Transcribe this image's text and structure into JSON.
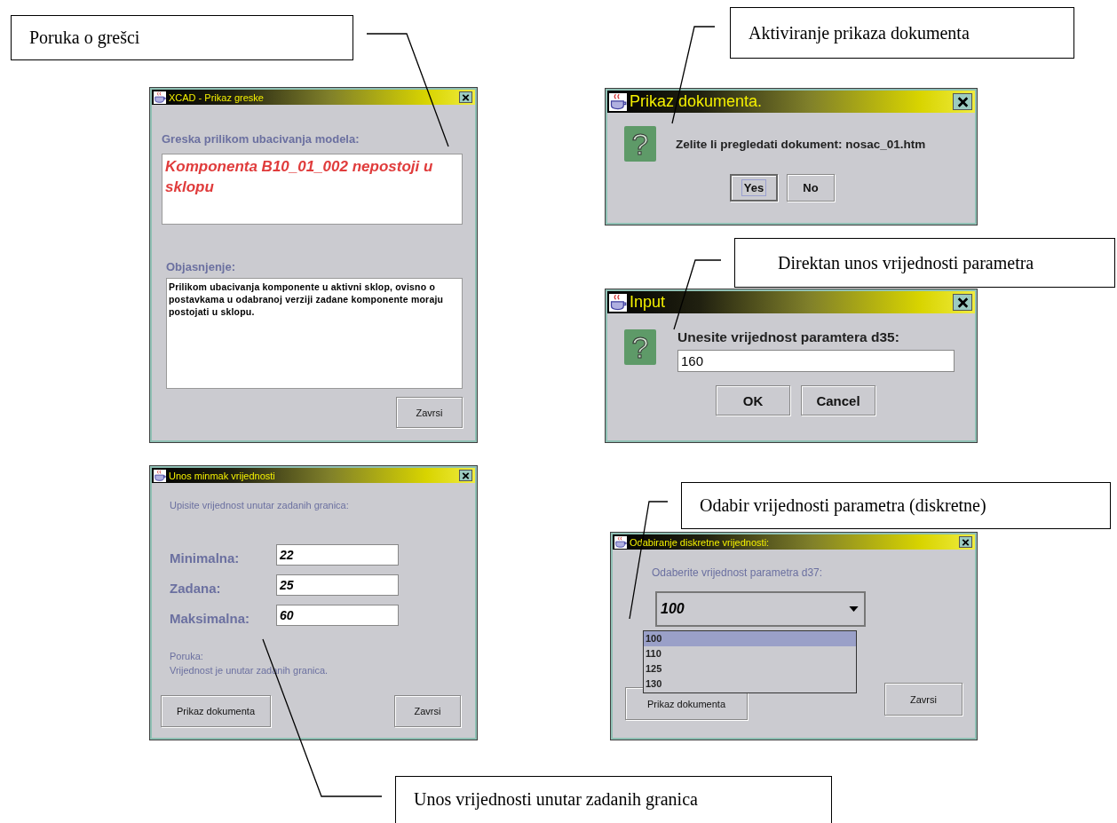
{
  "callouts": [
    {
      "text": "Poruka o grešci"
    },
    {
      "text": "Aktiviranje prikaza dokumenta"
    },
    {
      "text": "Direktan unos vrijednosti parametra"
    },
    {
      "text": "Odabir vrijednosti parametra (diskretne)"
    },
    {
      "text": "Unos vrijednosti unutar zadanih granica"
    }
  ],
  "windows": [
    {
      "kind": "error",
      "title": "XCAD - Prikaz greske",
      "heading": "Greska prilikom ubacivanja modela:",
      "message": "Komponenta B10_01_002 nepostoji u sklopu",
      "explanation_label": "Objasnjenje:",
      "explanation": "Prilikom ubacivanja komponente u aktivni sklop, ovisno o postavkama u odabranoj verziji zadane komponente moraju postojati u sklopu.",
      "buttons": [
        {
          "label": "Zavrsi",
          "focused": false
        }
      ]
    },
    {
      "kind": "confirm",
      "title": "Prikaz dokumenta.",
      "icon_glyph": "?",
      "message": "Zelite li pregledati dokument: nosac_01.htm",
      "buttons": [
        {
          "label": "Yes",
          "focused": true
        },
        {
          "label": "No",
          "focused": false
        }
      ]
    },
    {
      "kind": "input",
      "title": "Input",
      "icon_glyph": "?",
      "prompt": "Unesite vrijednost paramtera d35:",
      "value": "160",
      "buttons": [
        {
          "label": "OK",
          "focused": false
        },
        {
          "label": "Cancel",
          "focused": false
        }
      ]
    },
    {
      "kind": "range",
      "title": "Unos minmak vrijednosti",
      "instruction": "Upisite vrijednost unutar zadanih granica:",
      "fields": [
        {
          "label": "Minimalna:",
          "value": "22"
        },
        {
          "label": "Zadana:",
          "value": "25"
        },
        {
          "label": "Maksimalna:",
          "value": "60"
        }
      ],
      "message_label": "Poruka:",
      "message": "Vrijednost je unutar zadanih granica.",
      "buttons": [
        {
          "label": "Prikaz dokumenta",
          "focused": false
        },
        {
          "label": "Zavrsi",
          "focused": false
        }
      ]
    },
    {
      "kind": "choice",
      "title": "Odabiranje diskretne vrijednosti:",
      "prompt": "Odaberite vrijednost parametra d37:",
      "value": "100",
      "options": [
        {
          "label": "100",
          "selected": true
        },
        {
          "label": "110",
          "selected": false
        },
        {
          "label": "125",
          "selected": false
        },
        {
          "label": "130",
          "selected": false
        }
      ],
      "buttons": [
        {
          "label": "Prikaz dokumenta",
          "focused": false
        },
        {
          "label": "Zavrsi",
          "focused": false
        }
      ]
    }
  ]
}
